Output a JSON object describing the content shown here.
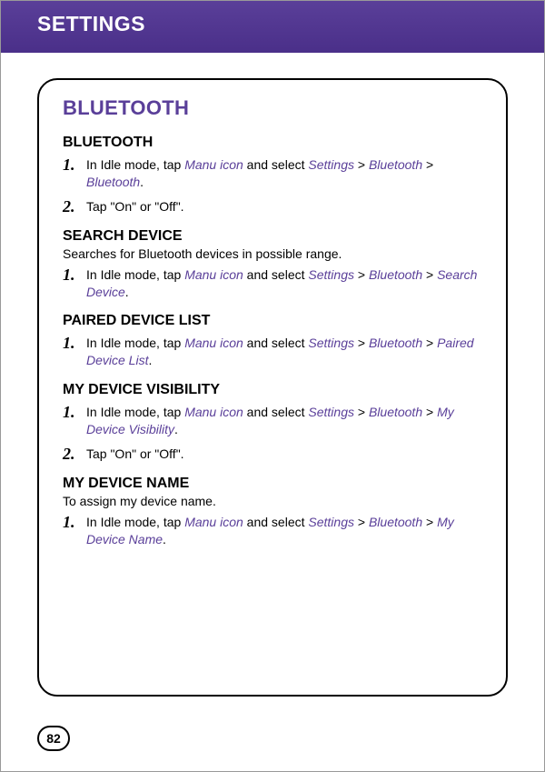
{
  "header": {
    "title": "SETTINGS"
  },
  "card": {
    "title": "BLUETOOTH",
    "groups": [
      {
        "heading": "BLUETOOTH",
        "desc": "",
        "steps": [
          {
            "n": "1.",
            "pre": "In Idle mode, tap ",
            "path": [
              "Manu icon"
            ],
            "mid": " and select ",
            "crumbs": [
              "Settings",
              "Bluetooth",
              "Bluetooth"
            ],
            "post": "."
          },
          {
            "n": "2.",
            "plain": "Tap \"On\" or \"Off\"."
          }
        ]
      },
      {
        "heading": "SEARCH DEVICE",
        "desc": "Searches for Bluetooth devices in possible range.",
        "steps": [
          {
            "n": "1.",
            "pre": "In Idle mode, tap ",
            "path": [
              "Manu icon"
            ],
            "mid": " and select ",
            "crumbs": [
              "Settings",
              "Bluetooth",
              "Search Device"
            ],
            "post": "."
          }
        ]
      },
      {
        "heading": "PAIRED DEVICE LIST",
        "desc": "",
        "steps": [
          {
            "n": "1.",
            "pre": "In Idle mode, tap ",
            "path": [
              "Manu icon"
            ],
            "mid": " and select ",
            "crumbs": [
              "Settings",
              "Bluetooth",
              "Paired Device List"
            ],
            "post": "."
          }
        ]
      },
      {
        "heading": "MY DEVICE VISIBILITY",
        "desc": "",
        "steps": [
          {
            "n": "1.",
            "pre": "In Idle mode, tap ",
            "path": [
              "Manu icon"
            ],
            "mid": " and select ",
            "crumbs": [
              "Settings",
              "Bluetooth",
              "My Device Visibility"
            ],
            "post": "."
          },
          {
            "n": "2.",
            "plain": "Tap \"On\" or \"Off\"."
          }
        ]
      },
      {
        "heading": "MY DEVICE NAME",
        "desc": "To assign my device name.",
        "steps": [
          {
            "n": "1.",
            "pre": "In Idle mode, tap ",
            "path": [
              "Manu icon"
            ],
            "mid": " and select ",
            "crumbs": [
              "Settings",
              "Bluetooth",
              "My Device Name"
            ],
            "post": "."
          }
        ]
      }
    ]
  },
  "page": "82"
}
